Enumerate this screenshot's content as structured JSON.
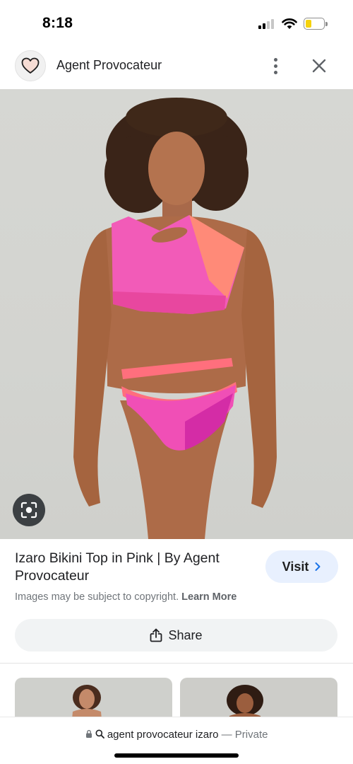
{
  "status_bar": {
    "time": "8:18",
    "icons": [
      "cellular-signal-icon",
      "wifi-icon",
      "battery-icon"
    ],
    "battery_color": "#f5d20e"
  },
  "header": {
    "site_icon": "heart-icon",
    "site_name": "Agent Provocateur",
    "actions": [
      "more-vertical-icon",
      "close-icon"
    ]
  },
  "image": {
    "description_icon": "lens-search-icon"
  },
  "result": {
    "title": "Izaro Bikini Top in Pink | By Agent Provocateur",
    "visit_label": "Visit",
    "copyright_text": "Images may be subject to copyright.",
    "learn_more": "Learn More",
    "share_label": "Share"
  },
  "url_bar": {
    "query": "agent provocateur izaro",
    "separator": "—",
    "private_label": "Private"
  },
  "colors": {
    "visit_bg": "#e8f0fe",
    "share_bg": "#f1f3f4",
    "image_bg": "#d6d7d3",
    "bikini_pink": "#f25bb8",
    "bikini_coral": "#ff7a66"
  }
}
